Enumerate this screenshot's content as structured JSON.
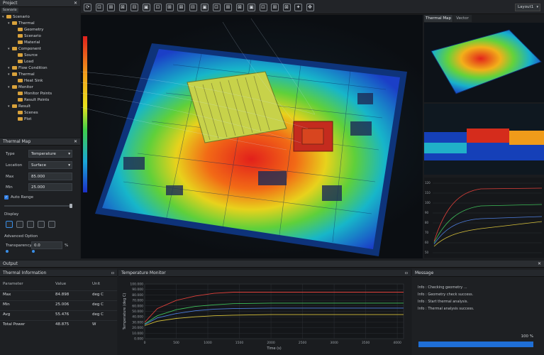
{
  "project": {
    "title": "Project",
    "tab": "Scenario",
    "tree": [
      {
        "label": "Scenario",
        "level": 0
      },
      {
        "label": "Thermal",
        "level": 1
      },
      {
        "label": "Geometry",
        "level": 2
      },
      {
        "label": "Scenario",
        "level": 2
      },
      {
        "label": "Material",
        "level": 2
      },
      {
        "label": "Component",
        "level": 1
      },
      {
        "label": "Source",
        "level": 2
      },
      {
        "label": "Load",
        "level": 2
      },
      {
        "label": "Flow Condition",
        "level": 1
      },
      {
        "label": "Thermal",
        "level": 1
      },
      {
        "label": "Heat Sink",
        "level": 2
      },
      {
        "label": "Monitor",
        "level": 1
      },
      {
        "label": "Monitor Points",
        "level": 2
      },
      {
        "label": "Result Points",
        "level": 2
      },
      {
        "label": "Result",
        "level": 1
      },
      {
        "label": "Scenes",
        "level": 2
      },
      {
        "label": "Plot",
        "level": 2
      }
    ]
  },
  "thermal_map": {
    "title": "Thermal Map",
    "type_label": "Type",
    "type_value": "Temperature",
    "location_label": "Location",
    "location_value": "Surface",
    "max_label": "Max",
    "max_value": "85.000",
    "min_label": "Min",
    "min_value": "25.000",
    "auto_range": "Auto Range",
    "display_label": "Display",
    "advanced_label": "Advanced Option",
    "transparency_label": "Transparency",
    "transparency_value": "0.0",
    "transparency_unit": "%"
  },
  "toolbar": {
    "layout_value": "Layout1"
  },
  "side_view": {
    "tab_thermal": "Thermal Map",
    "tab_vector": "Vector"
  },
  "mini_chart": {
    "ticks": [
      "120",
      "110",
      "100",
      "90",
      "80",
      "70",
      "60",
      "50"
    ]
  },
  "output": {
    "title": "Output"
  },
  "thermal_info": {
    "title": "Thermal Information",
    "headers": [
      "Parameter",
      "Value",
      "Unit"
    ],
    "rows": [
      {
        "name": "Max",
        "value": "84.898",
        "unit": "deg C"
      },
      {
        "name": "Min",
        "value": "25.006",
        "unit": "deg C"
      },
      {
        "name": "Avg",
        "value": "55.476",
        "unit": "deg C"
      },
      {
        "name": "Total Power",
        "value": "48.875",
        "unit": "W"
      }
    ]
  },
  "temperature_monitor": {
    "title": "Temperature Monitor"
  },
  "chart_data": {
    "type": "line",
    "xlabel": "Time (s)",
    "ylabel": "Temperature (deg C)",
    "xlim": [
      0,
      4100
    ],
    "ylim": [
      0,
      100
    ],
    "x_ticks": [
      "0",
      "500",
      "1000",
      "1500",
      "2000",
      "2500",
      "3000",
      "3500",
      "4000"
    ],
    "y_ticks": [
      "0.000",
      "10.000",
      "20.000",
      "30.000",
      "40.000",
      "50.000",
      "60.000",
      "70.000",
      "80.000",
      "90.000",
      "100.000"
    ],
    "grid": true,
    "series": [
      {
        "color": "#e0403a",
        "x": [
          0,
          200,
          500,
          800,
          1100,
          1400,
          2000,
          3000,
          4100
        ],
        "y": [
          30,
          55,
          70,
          78,
          83,
          85,
          85,
          85,
          85
        ]
      },
      {
        "color": "#3fbf5a",
        "x": [
          0,
          200,
          500,
          800,
          1100,
          1400,
          2000,
          3000,
          4100
        ],
        "y": [
          27,
          42,
          53,
          59,
          62,
          64,
          65,
          65,
          65
        ]
      },
      {
        "color": "#4f7fe0",
        "x": [
          0,
          200,
          500,
          800,
          1100,
          1400,
          2000,
          3000,
          4100
        ],
        "y": [
          26,
          38,
          46,
          51,
          54,
          55,
          56,
          56,
          56
        ]
      },
      {
        "color": "#d8c23a",
        "x": [
          0,
          200,
          500,
          800,
          1100,
          1400,
          2000,
          3000,
          4100
        ],
        "y": [
          24,
          32,
          37,
          40,
          42,
          43,
          44,
          44,
          44
        ]
      }
    ]
  },
  "message": {
    "title": "Message",
    "lines": [
      "Info : Checking geometry ...",
      "Info : Geometry check success.",
      "Info : Start thermal analysis.",
      "Info : Thermal analysis success."
    ],
    "progress": 100,
    "progress_text": "100 %"
  },
  "colors": {
    "accent": "#1f6fd6",
    "background": "#1b1d20"
  }
}
